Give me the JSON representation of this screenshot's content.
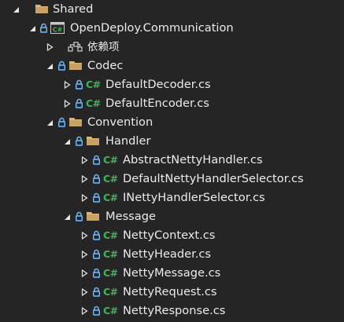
{
  "explorer": {
    "items": [
      {
        "label": "Shared",
        "icon": "folder-icon"
      },
      {
        "label": "OpenDeploy.Communication",
        "icon": "csharp-project-icon"
      },
      {
        "label": "依赖项",
        "icon": "dependencies-icon"
      },
      {
        "label": "Codec",
        "icon": "folder-icon"
      },
      {
        "label": "DefaultDecoder.cs",
        "icon": "csharp-file-icon"
      },
      {
        "label": "DefaultEncoder.cs",
        "icon": "csharp-file-icon"
      },
      {
        "label": "Convention",
        "icon": "folder-icon"
      },
      {
        "label": "Handler",
        "icon": "folder-icon"
      },
      {
        "label": "AbstractNettyHandler.cs",
        "icon": "csharp-file-icon"
      },
      {
        "label": "DefaultNettyHandlerSelector.cs",
        "icon": "csharp-file-icon"
      },
      {
        "label": "INettyHandlerSelector.cs",
        "icon": "csharp-file-icon"
      },
      {
        "label": "Message",
        "icon": "folder-icon"
      },
      {
        "label": "NettyContext.cs",
        "icon": "csharp-file-icon"
      },
      {
        "label": "NettyHeader.cs",
        "icon": "csharp-file-icon"
      },
      {
        "label": "NettyMessage.cs",
        "icon": "csharp-file-icon"
      },
      {
        "label": "NettyRequest.cs",
        "icon": "csharp-file-icon"
      },
      {
        "label": "NettyResponse.cs",
        "icon": "csharp-file-icon"
      }
    ],
    "csharp_glyph": "C#",
    "colors": {
      "background": "#252526",
      "text": "#ebebeb",
      "folder": "#dcb67a",
      "csharp": "#3fb55a",
      "lock": "#75beff"
    }
  }
}
